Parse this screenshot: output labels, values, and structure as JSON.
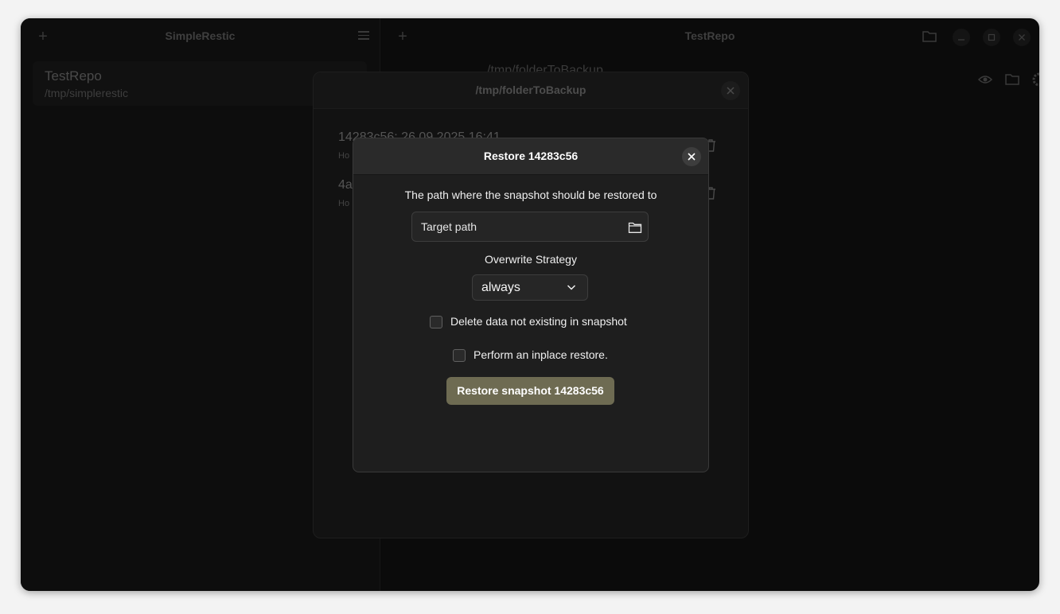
{
  "sidebar": {
    "title": "SimpleRestic",
    "repo": {
      "name": "TestRepo",
      "path": "/tmp/simplerestic"
    }
  },
  "main": {
    "title": "TestRepo",
    "subpath": "/tmp/folderToBackup"
  },
  "snapshots_dialog": {
    "title": "/tmp/folderToBackup",
    "snapshots": [
      {
        "id_date": "14283c56: 26.09.2025 16:41",
        "host": "Ho"
      },
      {
        "id_date": "4a",
        "host": "Ho"
      }
    ]
  },
  "restore_dialog": {
    "title": "Restore 14283c56",
    "path_label": "The path where the snapshot should be restored to",
    "target_placeholder": "Target path",
    "strategy_label": "Overwrite Strategy",
    "strategy_value": "always",
    "delete_option": "Delete data not existing in snapshot",
    "inplace_option": "Perform an inplace restore.",
    "restore_button": "Restore snapshot 14283c56",
    "accent_color": "#6e6b52"
  }
}
